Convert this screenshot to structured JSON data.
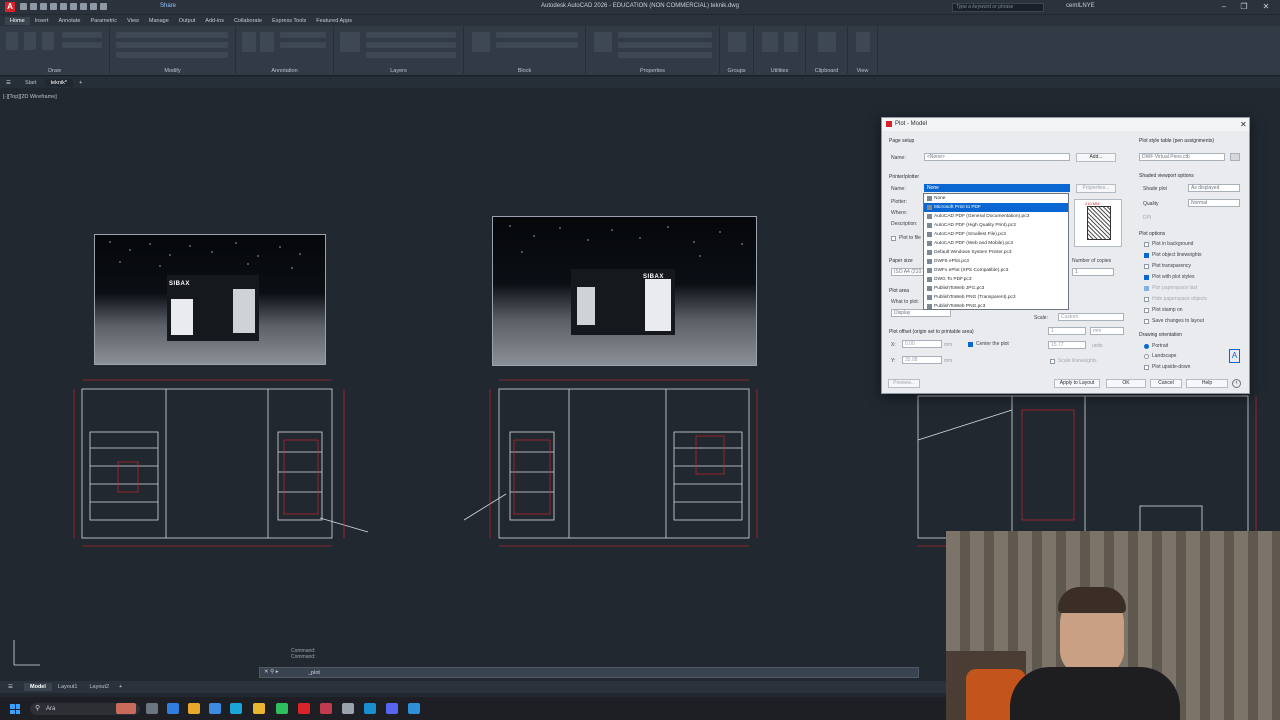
{
  "window": {
    "title": "Autodesk AutoCAD 2026 - EDUCATION (NON COMMERCIAL)    teknik.dwg",
    "app_logo": "A",
    "share_label": "Share",
    "search_placeholder": "Type a keyword or phrase",
    "user": "cemILNYE"
  },
  "ribbon_tabs": [
    "Home",
    "Insert",
    "Annotate",
    "Parametric",
    "View",
    "Manage",
    "Output",
    "Add-ins",
    "Collaborate",
    "Express Tools",
    "Featured Apps"
  ],
  "ribbon_panels": [
    "Draw",
    "Modify",
    "Annotation",
    "Layers",
    "Block",
    "Properties",
    "Groups",
    "Utilities",
    "Clipboard",
    "View"
  ],
  "file_tabs": [
    "Start",
    "teknik*"
  ],
  "viewport_label": "[-][Top][2D Wireframe]",
  "booth_logo": "SIBAX",
  "command": {
    "history": [
      "Command:",
      "Command:"
    ],
    "current": "_plot",
    "prefix": "✕ ⚲ ▸"
  },
  "layout_tabs": [
    "Model",
    "Layout1",
    "Layout2"
  ],
  "taskbar": {
    "search_text": "Ara"
  },
  "plot_dialog": {
    "title": "Plot - Model",
    "page_setup": {
      "section": "Page setup",
      "name_label": "Name:",
      "name_value": "<None>",
      "add_button": "Add..."
    },
    "printer": {
      "section": "Printer/plotter",
      "name_label": "Name:",
      "name_value": "None",
      "properties_button": "Properties...",
      "plotter_label": "Plotter:",
      "where_label": "Where:",
      "description_label": "Description:",
      "plot_to_file": "Plot to file",
      "options": [
        "None",
        "Microsoft Print to PDF",
        "AutoCAD PDF (General Documentation).pc3",
        "AutoCAD PDF (High Quality Print).pc3",
        "AutoCAD PDF (Smallest File).pc3",
        "AutoCAD PDF (Web and Mobile).pc3",
        "Default Windows System Printer.pc3",
        "DWF6 ePlot.pc3",
        "DWFx ePlot (XPS Compatible).pc3",
        "DWG To PDF.pc3",
        "PublishToWeb JPG.pc3",
        "PublishToWeb PNG (Transparent).pc3",
        "PublishToWeb PNG.pc3"
      ],
      "selected_option": "Microsoft Print to PDF",
      "preview_dims": "210 MM"
    },
    "paper_size": {
      "section": "Paper size",
      "value": "ISO A4 (210.00 x 297.00 MM)"
    },
    "copies": {
      "label": "Number of copies",
      "value": "1"
    },
    "plot_area": {
      "section": "Plot area",
      "what_label": "What to plot:",
      "value": "Display"
    },
    "plot_scale": {
      "scale_label": "Scale:",
      "scale_value": "Custom",
      "value1": "1",
      "unit": "mm",
      "value2": "15.77",
      "unit2": "units",
      "scale_lineweights": "Scale lineweights"
    },
    "plot_offset": {
      "section": "Plot offset (origin set to printable area)",
      "x_label": "X:",
      "x_value": "0.00",
      "y_label": "Y:",
      "y_value": "33.08",
      "unit": "mm",
      "center": "Center the plot"
    },
    "plot_style": {
      "section": "Plot style table (pen assignments)",
      "value": "DWF Virtual Pens.ctb"
    },
    "shaded_viewport": {
      "section": "Shaded viewport options",
      "shade_label": "Shade plot",
      "shade_value": "As displayed",
      "quality_label": "Quality",
      "quality_value": "Normal",
      "dpi_label": "DPI"
    },
    "plot_options": {
      "section": "Plot options",
      "items": [
        {
          "label": "Plot in background",
          "checked": false,
          "enabled": true
        },
        {
          "label": "Plot object lineweights",
          "checked": true,
          "enabled": true
        },
        {
          "label": "Plot transparency",
          "checked": false,
          "enabled": true
        },
        {
          "label": "Plot with plot styles",
          "checked": true,
          "enabled": true
        },
        {
          "label": "Plot paperspace last",
          "checked": true,
          "enabled": false
        },
        {
          "label": "Hide paperspace objects",
          "checked": false,
          "enabled": false
        },
        {
          "label": "Plot stamp on",
          "checked": false,
          "enabled": true
        },
        {
          "label": "Save changes to layout",
          "checked": false,
          "enabled": true
        }
      ]
    },
    "orientation": {
      "section": "Drawing orientation",
      "items": [
        "Portrait",
        "Landscape",
        "Plot upside-down"
      ],
      "selected": "Portrait"
    },
    "buttons": {
      "preview": "Preview...",
      "apply": "Apply to Layout",
      "ok": "OK",
      "cancel": "Cancel",
      "help": "Help"
    }
  },
  "colors": {
    "background": "#212830",
    "accent": "#0a67d2",
    "drawing_red": "#e0262b",
    "drawing_white": "#d9dde2"
  }
}
